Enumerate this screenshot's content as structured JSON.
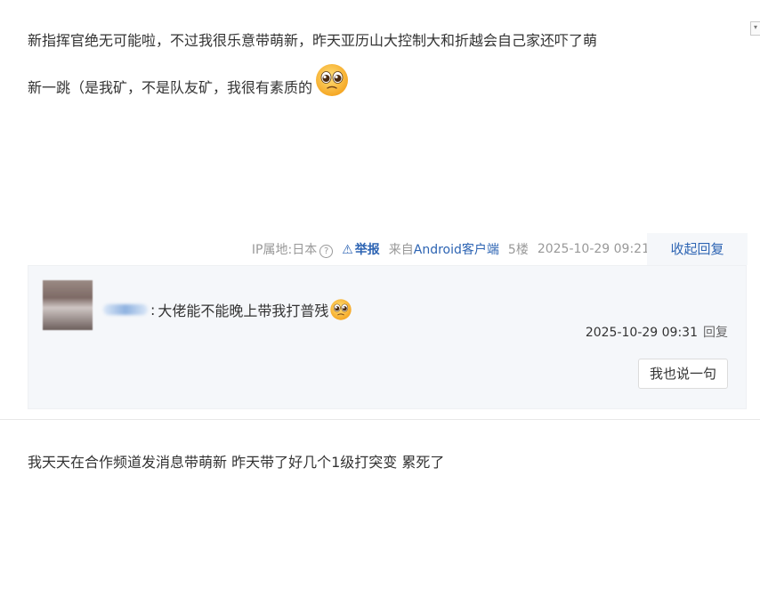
{
  "post1": {
    "text_line1": "新指挥官绝无可能啦，不过我很乐意带萌新，昨天亚历山大控制大和折越会自己家还吓了萌",
    "text_line2": "新一跳（是我矿，不是队友矿，我很有素质的",
    "emoji": "pleading-face-emoji"
  },
  "meta": {
    "ip": "IP属地:日本",
    "report_label": "举报",
    "client_prefix": "来自",
    "client_name": "Android客户端",
    "floor": "5楼",
    "timestamp": "2025-10-29 09:21",
    "collapse_label": "收起回复"
  },
  "reply": {
    "separator": ":",
    "text": "大佬能不能晚上带我打普残",
    "emoji": "pleading-face-emoji",
    "timestamp": "2025-10-29 09:31",
    "reply_label": "回复",
    "say_button": "我也说一句"
  },
  "post2": {
    "text": "我天天在合作频道发消息带萌新 昨天带了好几个1级打突变 累死了"
  },
  "colors": {
    "link": "#2d64b3",
    "meta_gray": "#999999",
    "reply_bg": "#f5f7fa"
  }
}
